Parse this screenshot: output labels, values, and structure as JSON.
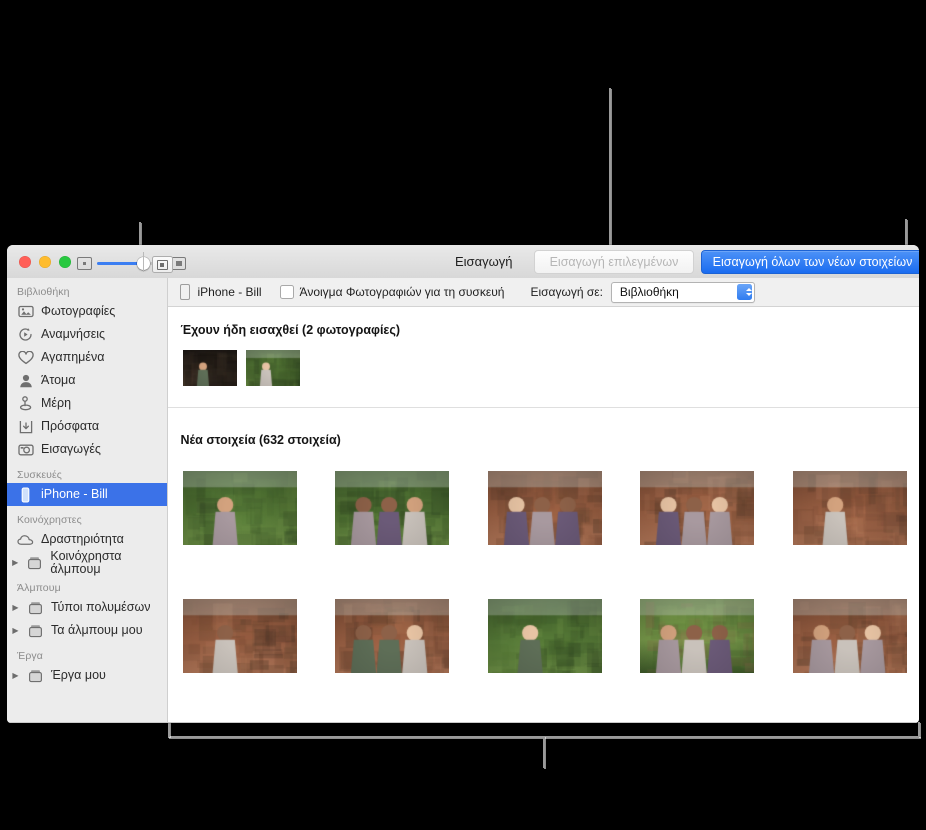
{
  "window": {
    "toolbar": {
      "title": "Εισαγωγή",
      "import_selected_label": "Εισαγωγή επιλεγμένων",
      "import_all_label": "Εισαγωγή όλων των νέων στοιχείων",
      "zoom_out_icon": "small-thumbnail-icon",
      "zoom_in_icon": "large-thumbnail-icon",
      "info_button_icon": "info-panel-icon",
      "zoom_value": 83
    },
    "device_bar": {
      "device_icon": "iphone-icon",
      "device_name": "iPhone - Bill",
      "open_photos_checkbox_label": "Άνοιγμα Φωτογραφιών για τη συσκευή",
      "open_photos_checked": false,
      "import_to_label": "Εισαγωγή σε:",
      "import_to_value": "Βιβλιοθήκη",
      "import_to_options": [
        "Βιβλιοθήκη"
      ]
    }
  },
  "sidebar": {
    "groups": [
      {
        "header": "Βιβλιοθήκη",
        "items": [
          {
            "label": "Φωτογραφίες",
            "icon": "photos-icon",
            "disclosure": false,
            "selected": false
          },
          {
            "label": "Αναμνήσεις",
            "icon": "memories-icon",
            "disclosure": false,
            "selected": false
          },
          {
            "label": "Αγαπημένα",
            "icon": "heart-icon",
            "disclosure": false,
            "selected": false
          },
          {
            "label": "Άτομα",
            "icon": "person-icon",
            "disclosure": false,
            "selected": false
          },
          {
            "label": "Μέρη",
            "icon": "pin-icon",
            "disclosure": false,
            "selected": false
          },
          {
            "label": "Πρόσφατα",
            "icon": "recents-icon",
            "disclosure": false,
            "selected": false
          },
          {
            "label": "Εισαγωγές",
            "icon": "camera-icon",
            "disclosure": false,
            "selected": false
          }
        ]
      },
      {
        "header": "Συσκευές",
        "items": [
          {
            "label": "iPhone - Bill",
            "icon": "iphone-icon",
            "disclosure": false,
            "selected": true
          }
        ]
      },
      {
        "header": "Κοινόχρηστες",
        "items": [
          {
            "label": "Δραστηριότητα",
            "icon": "cloud-icon",
            "disclosure": false,
            "selected": false
          },
          {
            "label": "Κοινόχρηστα άλμπουμ",
            "icon": "album-icon",
            "disclosure": true,
            "selected": false
          }
        ]
      },
      {
        "header": "Άλμπουμ",
        "items": [
          {
            "label": "Τύποι πολυμέσων",
            "icon": "album-icon",
            "disclosure": true,
            "selected": false
          },
          {
            "label": "Τα άλμπουμ μου",
            "icon": "album-icon",
            "disclosure": true,
            "selected": false
          }
        ]
      },
      {
        "header": "Έργα",
        "items": [
          {
            "label": "Έργα μου",
            "icon": "album-icon",
            "disclosure": true,
            "selected": false
          }
        ]
      }
    ]
  },
  "content": {
    "already_imported": {
      "title": "Έχουν ήδη εισαχθεί (2 φωτογραφίες)",
      "count": 2,
      "thumbnails": [
        {
          "name": "man-in-cafe"
        },
        {
          "name": "man-with-backpack-garden"
        }
      ]
    },
    "new_items": {
      "title": "Νέα στοιχεία (632 στοιχεία)",
      "count": 632,
      "thumbnails": [
        {
          "name": "woman-hiker-closeup"
        },
        {
          "name": "two-hikers-path"
        },
        {
          "name": "group-at-temple"
        },
        {
          "name": "friends-sitting-ruins"
        },
        {
          "name": "woman-at-brick-temple"
        },
        {
          "name": "woman-in-temple-doorway"
        },
        {
          "name": "two-people-in-archway"
        },
        {
          "name": "hiker-by-tree"
        },
        {
          "name": "couple-on-lawn"
        },
        {
          "name": "two-women-market"
        }
      ]
    }
  },
  "callouts": {
    "colors": {
      "line": "#9a9a9a",
      "accent": "#1a6cf0",
      "selection": "#3b72e8"
    },
    "items": [
      {
        "name": "sidebar-callout",
        "target": "sidebar"
      },
      {
        "name": "import-to-callout",
        "target": "import-to-popup"
      },
      {
        "name": "import-all-callout",
        "target": "import-all-button"
      },
      {
        "name": "content-area-callout",
        "target": "photo-grid"
      }
    ]
  }
}
